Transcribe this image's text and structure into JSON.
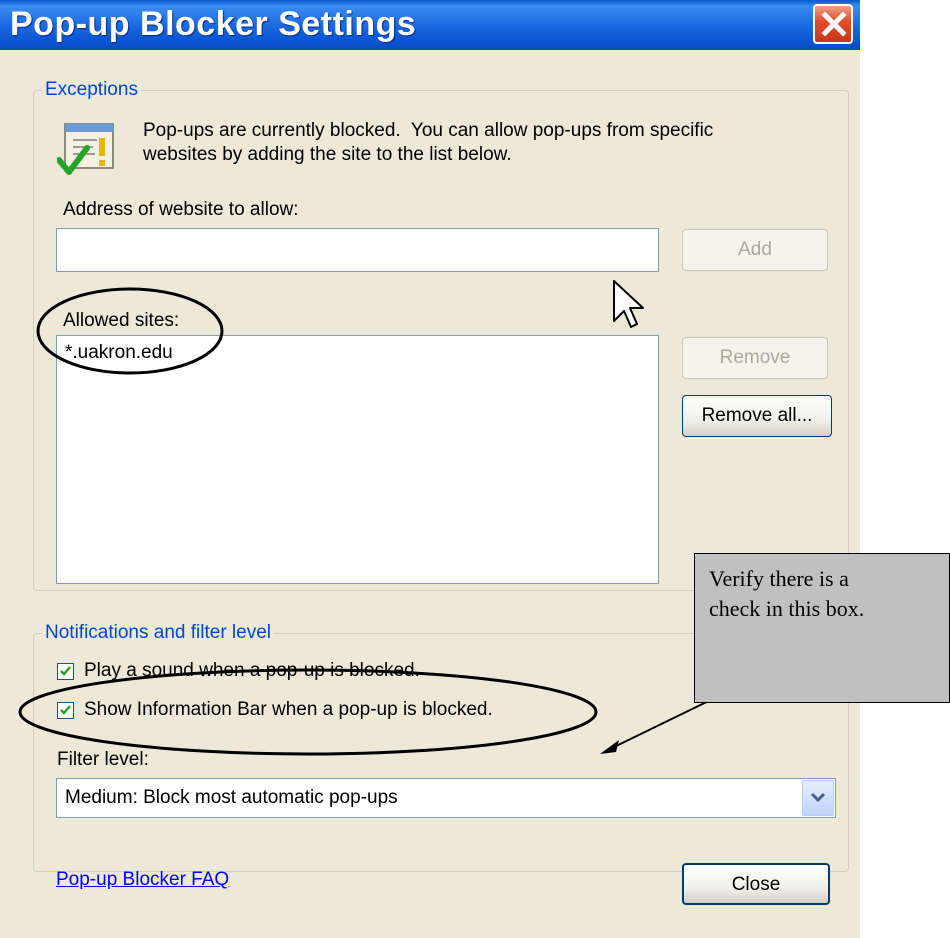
{
  "window": {
    "title": "Pop-up Blocker Settings",
    "close_icon": "close-x-icon"
  },
  "exceptions": {
    "legend": "Exceptions",
    "info_text_line1": "Pop-ups are currently blocked.  You can allow pop-ups from specific",
    "info_text_line2": "websites by adding the site to the list below.",
    "info_icon": "popup-blocker-info-icon",
    "address_label": "Address of website to allow:",
    "address_value": "",
    "add_button": "Add",
    "allowed_label": "Allowed sites:",
    "allowed_sites": [
      "*.uakron.edu"
    ],
    "remove_button": "Remove",
    "remove_all_button": "Remove all..."
  },
  "notifications": {
    "legend": "Notifications and filter level",
    "play_sound_label": "Play a sound when a pop-up is blocked.",
    "play_sound_checked": true,
    "show_infobar_label": "Show Information Bar when a pop-up is blocked.",
    "show_infobar_checked": true,
    "filter_label": "Filter level:",
    "filter_value": "Medium: Block most automatic pop-ups"
  },
  "footer": {
    "faq_link": "Pop-up Blocker FAQ",
    "close_button": "Close"
  },
  "annotation": {
    "callout_line1": "Verify there is a",
    "callout_line2": "check in this box."
  },
  "colors": {
    "titlebar": "#0b55d2",
    "dialog_bg": "#ece9d8",
    "legend_text": "#0046d5",
    "link": "#0000ff",
    "callout_bg": "#c0c0c0"
  }
}
